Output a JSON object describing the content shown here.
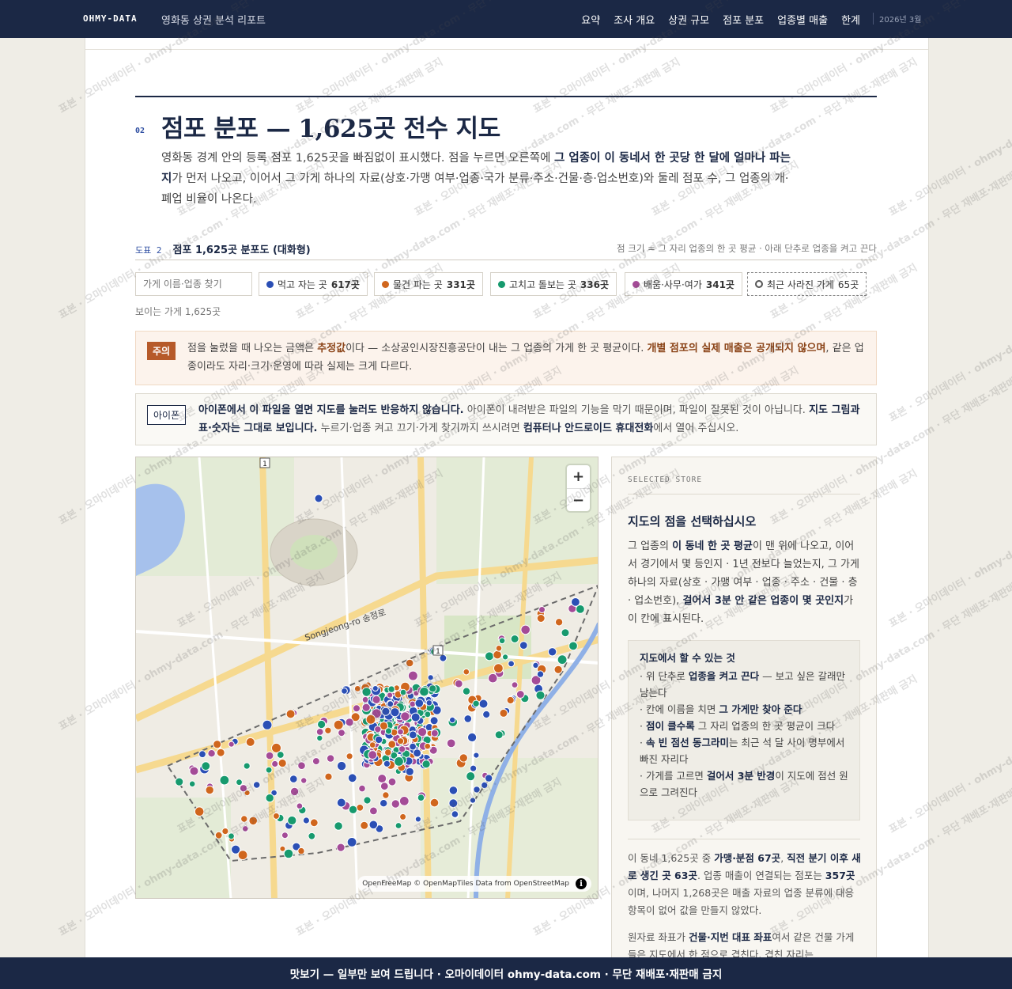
{
  "header": {
    "brand": "OHMY-DATA",
    "report_title": "영화동 상권 분석 리포트",
    "nav": [
      "요약",
      "조사 개요",
      "상권 규모",
      "점포 분포",
      "업종별 매출",
      "한계"
    ],
    "date": "2026년 3월"
  },
  "section": {
    "number": "02",
    "title": "점포 분포 — 1,625곳 전수 지도",
    "lede_1": "영화동 경계 안의 등록 점포 1,625곳을 빠짐없이 표시했다. 점을 누르면 오른쪽에 ",
    "lede_bold": "그 업종이 이 동네서 한 곳당 한 달에 얼마나 파는지",
    "lede_2": "가 먼저 나오고, 이어서 그 가게 하나의 자료(상호·가맹 여부·업종·국가 분류·주소·건물·층·업소번호)와 둘레 점포 수, 그 업종의 개·폐업 비율이 나온다."
  },
  "figure": {
    "label_no": "도표 2",
    "label_title": "점포 1,625곳 분포도 (대화형)",
    "note": "점 크기 = 그 자리 업종의 한 곳 평균 · 아래 단추로 업종을 켜고 끈다",
    "search_placeholder": "가게 이름·업종 찾기",
    "visible_count": "보이는 가게 1,625곳"
  },
  "chips": [
    {
      "label": "먹고 자는 곳",
      "count": "617곳",
      "color": "#2b4fb5"
    },
    {
      "label": "물건 파는 곳",
      "count": "331곳",
      "color": "#d0661d"
    },
    {
      "label": "고치고 돌보는 곳",
      "count": "336곳",
      "color": "#179a6e"
    },
    {
      "label": "배움·사무·여가",
      "count": "341곳",
      "color": "#a44b97"
    },
    {
      "label": "최근 사라진 가게",
      "count": "65곳",
      "color": "#555555"
    }
  ],
  "warning": {
    "tag": "주의",
    "t1": "점을 눌렀을 때 나오는 금액은 ",
    "b1": "추정값",
    "t2": "이다 — 소상공인시장진흥공단이 내는 그 업종의 가게 한 곳 평균이다. ",
    "b2": "개별 점포의 실제 매출은 공개되지 않으며",
    "t3": ", 같은 업종이라도 자리·크기·운영에 따라 실제는 크게 다르다."
  },
  "iphone": {
    "tag": "아이폰",
    "b1": "아이폰에서 이 파일을 열면 지도를 눌러도 반응하지 않습니다.",
    "t1": " 아이폰이 내려받은 파일의 기능을 막기 때문이며, 파일이 잘못된 것이 아닙니다. ",
    "b2": "지도 그림과 표·숫자는 그대로 보입니다.",
    "t2": " 누르기·업종 켜고 끄기·가게 찾기까지 쓰시려면 ",
    "b3": "컴퓨터나 안드로이드 휴대전화",
    "t3": "에서 열어 주십시오."
  },
  "map": {
    "road_label": "Songjeong-ro 송정로",
    "route_1": "1",
    "route_2": "1",
    "attribution": "OpenFreeMap © OpenMapTiles Data from OpenStreetMap",
    "zoom_in": "+",
    "zoom_out": "−",
    "info": "i"
  },
  "panel": {
    "eyebrow": "SELECTED STORE",
    "title": "지도의 점을 선택하십시오",
    "p_t1": "그 업종의 ",
    "p_b1": "이 동네 한 곳 평균",
    "p_t2": "이 맨 위에 나오고, 이어서 경기에서 몇 등인지 · 1년 전보다 늘었는지, 그 가게 하나의 자료(상호 · 가맹 여부 · 업종 · 주소 · 건물 · 층 · 업소번호), ",
    "p_b2": "걸어서 3분 안 같은 업종이 몇 곳인지",
    "p_t3": "가 이 칸에 표시된다.",
    "howto_title": "지도에서 할 수 있는 것",
    "h1_t1": "· 위 단추로 ",
    "h1_b": "업종을 켜고 끈다",
    "h1_t2": " — 보고 싶은 갈래만 남는다",
    "h2_t1": "· 칸에 이름을 치면 ",
    "h2_b": "그 가게만 찾아 준다",
    "h3_t1": "· ",
    "h3_b": "점이 클수록",
    "h3_t2": " 그 자리 업종의 한 곳 평균이 크다",
    "h4_t1": "· ",
    "h4_b": "속 빈 점선 동그라미",
    "h4_t2": "는 최근 석 달 사이 명부에서 빠진 자리다",
    "h5_t1": "· 가게를 고르면 ",
    "h5_b": "걸어서 3분 반경",
    "h5_t2": "이 지도에 점선 원으로 그려진다",
    "s_t1": "이 동네 1,625곳 중 ",
    "s_b1": "가맹·분점 67곳",
    "s_t2": ", ",
    "s_b2": "직전 분기 이후 새로 생긴 곳 63곳",
    "s_t3": ". 업종 매출이 연결되는 점포는 ",
    "s_b3": "357곳",
    "s_t4": "이며, 나머지 1,268곳은 매출 자료의 업종 분류에 대응 항목이 없어 값을 만들지 않았다.",
    "r_t1": "원자료 좌표가 ",
    "r_b1": "건물·지번 대표 좌표",
    "r_t2": "여서 같은 건물 가게들은 지도에서 한 점으로 겹친다. 겹친 자리는"
  },
  "footer": {
    "text": "맛보기 — 일부만 보여 드립니다 · 오마이데이터 ohmy-data.com · 무단 재배포·재판매 금지"
  },
  "watermark": {
    "text": "표본 · 오마이데이터 · ohmy-data.com · 무단 재배포·재판매 금지"
  }
}
